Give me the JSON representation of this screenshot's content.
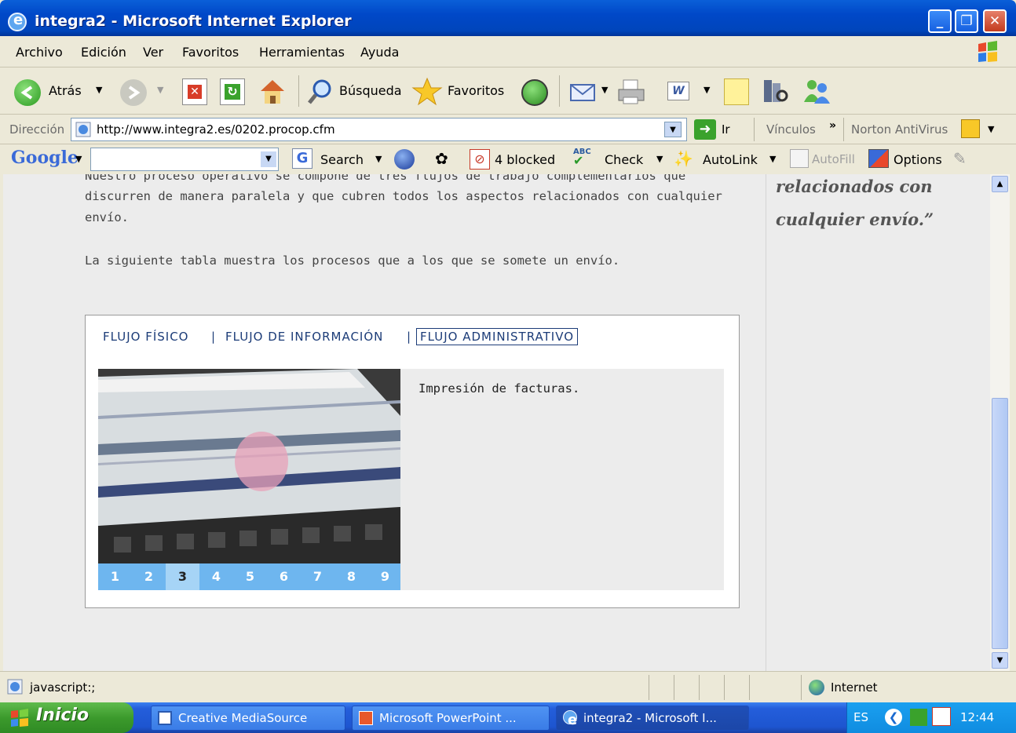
{
  "window": {
    "title": "integra2 - Microsoft Internet Explorer"
  },
  "menu": [
    "Archivo",
    "Edición",
    "Ver",
    "Favoritos",
    "Herramientas",
    "Ayuda"
  ],
  "toolbar": {
    "back": "Atrás",
    "search": "Búsqueda",
    "favorites": "Favoritos"
  },
  "address": {
    "label": "Dirección",
    "url": "http://www.integra2.es/0202.procop.cfm",
    "go": "Ir",
    "links": "Vínculos",
    "norton": "Norton AntiVirus"
  },
  "google": {
    "logo": "Google",
    "search": "Search",
    "blocked": "4 blocked",
    "check": "Check",
    "autolink": "AutoLink",
    "autofill": "AutoFill",
    "options": "Options"
  },
  "page": {
    "para1_line0": "Nuestro proceso operativo se compone de tres flujos de trabajo complementarios que",
    "para1_line1": "discurren de manera paralela y que cubren todos los aspectos relacionados con cualquier",
    "para1_line2": "envío.",
    "para2": "La siguiente tabla muestra los procesos que a los que se somete un envío.",
    "quote_line1": "relacionados con",
    "quote_line2": "cualquier envío.”",
    "tabs": [
      "FLUJO FÍSICO",
      "FLUJO DE INFORMACIÓN",
      "FLUJO ADMINISTRATIVO"
    ],
    "tab_sep": "|",
    "caption": "Impresión de facturas.",
    "pages": [
      "1",
      "2",
      "3",
      "4",
      "5",
      "6",
      "7",
      "8",
      "9"
    ],
    "active_page": "3"
  },
  "status": {
    "text": "javascript:;",
    "zone": "Internet"
  },
  "taskbar": {
    "start": "Inicio",
    "tasks": [
      "Creative MediaSource",
      "Microsoft PowerPoint ...",
      "integra2 - Microsoft I..."
    ],
    "lang": "ES",
    "clock": "12:44"
  }
}
